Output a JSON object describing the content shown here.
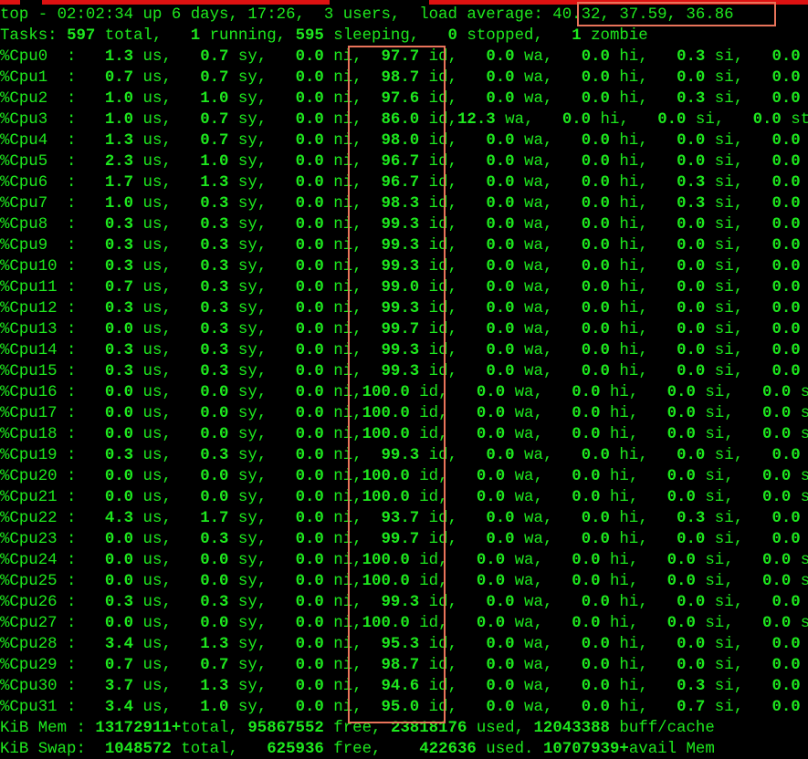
{
  "theme": {
    "fg": "#1ee81e",
    "bg": "#000000",
    "highlight": "#e8735a",
    "topbar": "#dd1111"
  },
  "header": {
    "line1": "top - 02:02:34 up 6 days, 17:26,  3 users,  load average: 40.32, 37.59, 36.86",
    "tasks": {
      "total": "597",
      "running": "1",
      "sleeping": "595",
      "stopped": "0",
      "zombie": "1"
    }
  },
  "cpus": [
    {
      "name": "%Cpu0",
      "us": "1.3",
      "sy": "0.7",
      "ni": "0.0",
      "id": "97.7",
      "wa": "0.0",
      "hi": "0.0",
      "si": "0.3",
      "st": "0.0"
    },
    {
      "name": "%Cpu1",
      "us": "0.7",
      "sy": "0.7",
      "ni": "0.0",
      "id": "98.7",
      "wa": "0.0",
      "hi": "0.0",
      "si": "0.0",
      "st": "0.0"
    },
    {
      "name": "%Cpu2",
      "us": "1.0",
      "sy": "1.0",
      "ni": "0.0",
      "id": "97.6",
      "wa": "0.0",
      "hi": "0.0",
      "si": "0.3",
      "st": "0.0"
    },
    {
      "name": "%Cpu3",
      "us": "1.0",
      "sy": "0.7",
      "ni": "0.0",
      "id": "86.0",
      "wa": "12.3",
      "hi": "0.0",
      "si": "0.0",
      "st": "0.0"
    },
    {
      "name": "%Cpu4",
      "us": "1.3",
      "sy": "0.7",
      "ni": "0.0",
      "id": "98.0",
      "wa": "0.0",
      "hi": "0.0",
      "si": "0.0",
      "st": "0.0"
    },
    {
      "name": "%Cpu5",
      "us": "2.3",
      "sy": "1.0",
      "ni": "0.0",
      "id": "96.7",
      "wa": "0.0",
      "hi": "0.0",
      "si": "0.0",
      "st": "0.0"
    },
    {
      "name": "%Cpu6",
      "us": "1.7",
      "sy": "1.3",
      "ni": "0.0",
      "id": "96.7",
      "wa": "0.0",
      "hi": "0.0",
      "si": "0.3",
      "st": "0.0"
    },
    {
      "name": "%Cpu7",
      "us": "1.0",
      "sy": "0.3",
      "ni": "0.0",
      "id": "98.3",
      "wa": "0.0",
      "hi": "0.0",
      "si": "0.3",
      "st": "0.0"
    },
    {
      "name": "%Cpu8",
      "us": "0.3",
      "sy": "0.3",
      "ni": "0.0",
      "id": "99.3",
      "wa": "0.0",
      "hi": "0.0",
      "si": "0.0",
      "st": "0.0"
    },
    {
      "name": "%Cpu9",
      "us": "0.3",
      "sy": "0.3",
      "ni": "0.0",
      "id": "99.3",
      "wa": "0.0",
      "hi": "0.0",
      "si": "0.0",
      "st": "0.0"
    },
    {
      "name": "%Cpu10",
      "us": "0.3",
      "sy": "0.3",
      "ni": "0.0",
      "id": "99.3",
      "wa": "0.0",
      "hi": "0.0",
      "si": "0.0",
      "st": "0.0"
    },
    {
      "name": "%Cpu11",
      "us": "0.7",
      "sy": "0.3",
      "ni": "0.0",
      "id": "99.0",
      "wa": "0.0",
      "hi": "0.0",
      "si": "0.0",
      "st": "0.0"
    },
    {
      "name": "%Cpu12",
      "us": "0.3",
      "sy": "0.3",
      "ni": "0.0",
      "id": "99.3",
      "wa": "0.0",
      "hi": "0.0",
      "si": "0.0",
      "st": "0.0"
    },
    {
      "name": "%Cpu13",
      "us": "0.0",
      "sy": "0.3",
      "ni": "0.0",
      "id": "99.7",
      "wa": "0.0",
      "hi": "0.0",
      "si": "0.0",
      "st": "0.0"
    },
    {
      "name": "%Cpu14",
      "us": "0.3",
      "sy": "0.3",
      "ni": "0.0",
      "id": "99.3",
      "wa": "0.0",
      "hi": "0.0",
      "si": "0.0",
      "st": "0.0"
    },
    {
      "name": "%Cpu15",
      "us": "0.3",
      "sy": "0.3",
      "ni": "0.0",
      "id": "99.3",
      "wa": "0.0",
      "hi": "0.0",
      "si": "0.0",
      "st": "0.0"
    },
    {
      "name": "%Cpu16",
      "us": "0.0",
      "sy": "0.0",
      "ni": "0.0",
      "id": "100.0",
      "wa": "0.0",
      "hi": "0.0",
      "si": "0.0",
      "st": "0.0"
    },
    {
      "name": "%Cpu17",
      "us": "0.0",
      "sy": "0.0",
      "ni": "0.0",
      "id": "100.0",
      "wa": "0.0",
      "hi": "0.0",
      "si": "0.0",
      "st": "0.0"
    },
    {
      "name": "%Cpu18",
      "us": "0.0",
      "sy": "0.0",
      "ni": "0.0",
      "id": "100.0",
      "wa": "0.0",
      "hi": "0.0",
      "si": "0.0",
      "st": "0.0"
    },
    {
      "name": "%Cpu19",
      "us": "0.3",
      "sy": "0.3",
      "ni": "0.0",
      "id": "99.3",
      "wa": "0.0",
      "hi": "0.0",
      "si": "0.0",
      "st": "0.0"
    },
    {
      "name": "%Cpu20",
      "us": "0.0",
      "sy": "0.0",
      "ni": "0.0",
      "id": "100.0",
      "wa": "0.0",
      "hi": "0.0",
      "si": "0.0",
      "st": "0.0"
    },
    {
      "name": "%Cpu21",
      "us": "0.0",
      "sy": "0.0",
      "ni": "0.0",
      "id": "100.0",
      "wa": "0.0",
      "hi": "0.0",
      "si": "0.0",
      "st": "0.0"
    },
    {
      "name": "%Cpu22",
      "us": "4.3",
      "sy": "1.7",
      "ni": "0.0",
      "id": "93.7",
      "wa": "0.0",
      "hi": "0.0",
      "si": "0.3",
      "st": "0.0"
    },
    {
      "name": "%Cpu23",
      "us": "0.0",
      "sy": "0.3",
      "ni": "0.0",
      "id": "99.7",
      "wa": "0.0",
      "hi": "0.0",
      "si": "0.0",
      "st": "0.0"
    },
    {
      "name": "%Cpu24",
      "us": "0.0",
      "sy": "0.0",
      "ni": "0.0",
      "id": "100.0",
      "wa": "0.0",
      "hi": "0.0",
      "si": "0.0",
      "st": "0.0"
    },
    {
      "name": "%Cpu25",
      "us": "0.0",
      "sy": "0.0",
      "ni": "0.0",
      "id": "100.0",
      "wa": "0.0",
      "hi": "0.0",
      "si": "0.0",
      "st": "0.0"
    },
    {
      "name": "%Cpu26",
      "us": "0.3",
      "sy": "0.3",
      "ni": "0.0",
      "id": "99.3",
      "wa": "0.0",
      "hi": "0.0",
      "si": "0.0",
      "st": "0.0"
    },
    {
      "name": "%Cpu27",
      "us": "0.0",
      "sy": "0.0",
      "ni": "0.0",
      "id": "100.0",
      "wa": "0.0",
      "hi": "0.0",
      "si": "0.0",
      "st": "0.0"
    },
    {
      "name": "%Cpu28",
      "us": "3.4",
      "sy": "1.3",
      "ni": "0.0",
      "id": "95.3",
      "wa": "0.0",
      "hi": "0.0",
      "si": "0.0",
      "st": "0.0"
    },
    {
      "name": "%Cpu29",
      "us": "0.7",
      "sy": "0.7",
      "ni": "0.0",
      "id": "98.7",
      "wa": "0.0",
      "hi": "0.0",
      "si": "0.0",
      "st": "0.0"
    },
    {
      "name": "%Cpu30",
      "us": "3.7",
      "sy": "1.3",
      "ni": "0.0",
      "id": "94.6",
      "wa": "0.0",
      "hi": "0.0",
      "si": "0.3",
      "st": "0.0"
    },
    {
      "name": "%Cpu31",
      "us": "3.4",
      "sy": "1.0",
      "ni": "0.0",
      "id": "95.0",
      "wa": "0.0",
      "hi": "0.0",
      "si": "0.7",
      "st": "0.0"
    }
  ],
  "mem": {
    "label": "KiB Mem :",
    "total": "13172911+",
    "free": "95867552",
    "used": "23818176",
    "buff_cache": "12043388"
  },
  "swap": {
    "label": "KiB Swap:",
    "total": "1048572",
    "free": "625936",
    "used": "422636",
    "avail": "10707939+"
  }
}
